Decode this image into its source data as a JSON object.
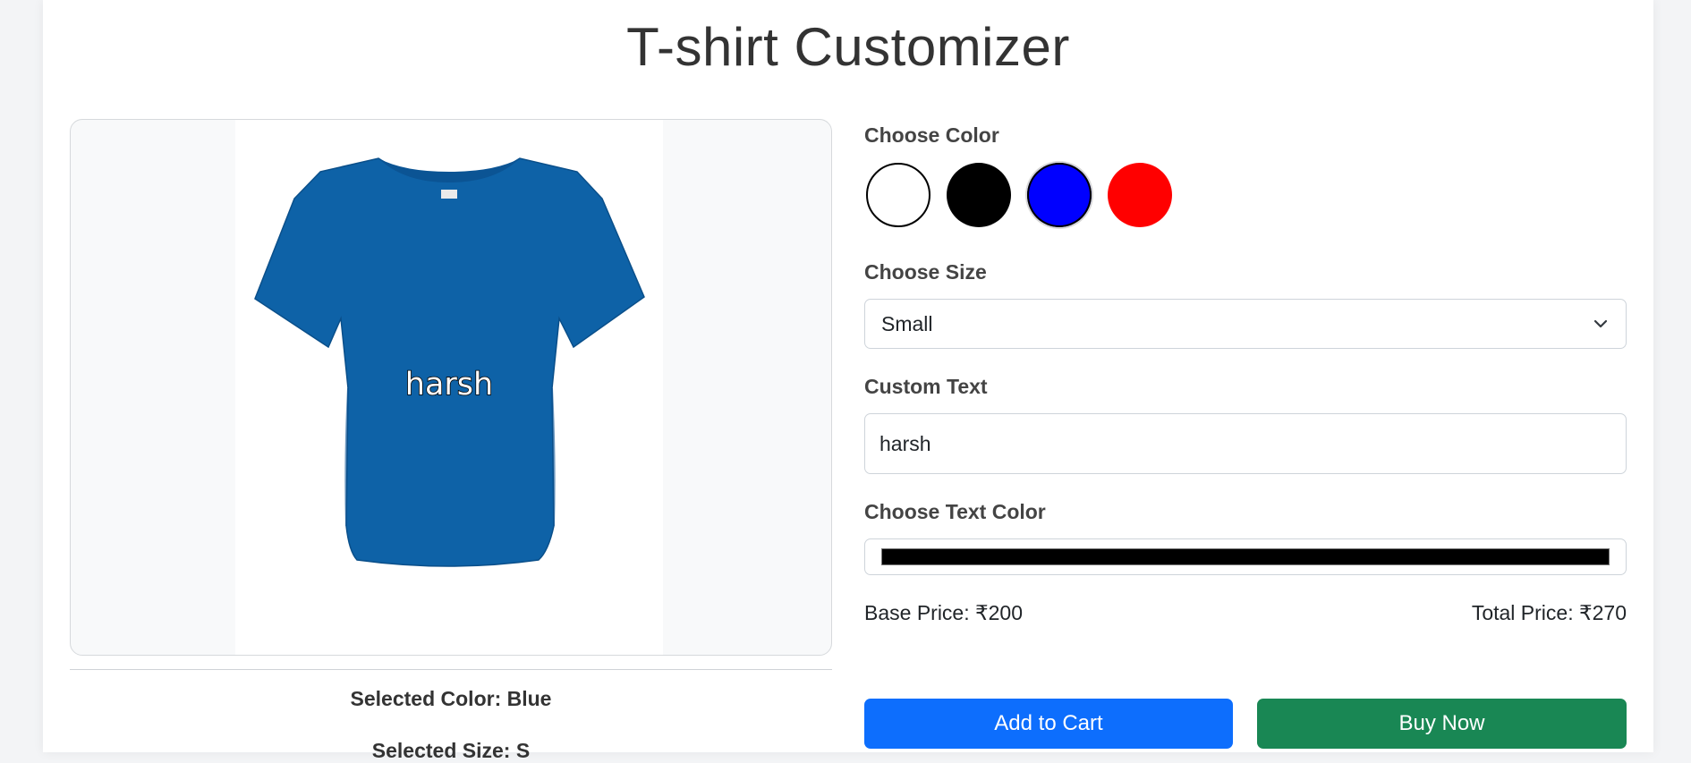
{
  "page": {
    "title": "T-shirt Customizer"
  },
  "preview": {
    "shirt_color": "#0e62a7",
    "custom_text": "harsh",
    "selected_color_text": "Selected Color: Blue",
    "selected_size_text": "Selected Size: S"
  },
  "controls": {
    "color_label": "Choose Color",
    "colors": [
      {
        "name": "White",
        "hex": "#ffffff"
      },
      {
        "name": "Black",
        "hex": "#000000"
      },
      {
        "name": "Blue",
        "hex": "#0000ff"
      },
      {
        "name": "Red",
        "hex": "#ff0000"
      }
    ],
    "selected_color_index": 2,
    "size_label": "Choose Size",
    "size_value": "Small",
    "text_label": "Custom Text",
    "text_value": "harsh",
    "text_color_label": "Choose Text Color",
    "text_color_value": "#000000"
  },
  "pricing": {
    "base_price": "Base Price: ₹200",
    "total_price": "Total Price: ₹270"
  },
  "buttons": {
    "add_to_cart": "Add to Cart",
    "buy_now": "Buy Now"
  }
}
